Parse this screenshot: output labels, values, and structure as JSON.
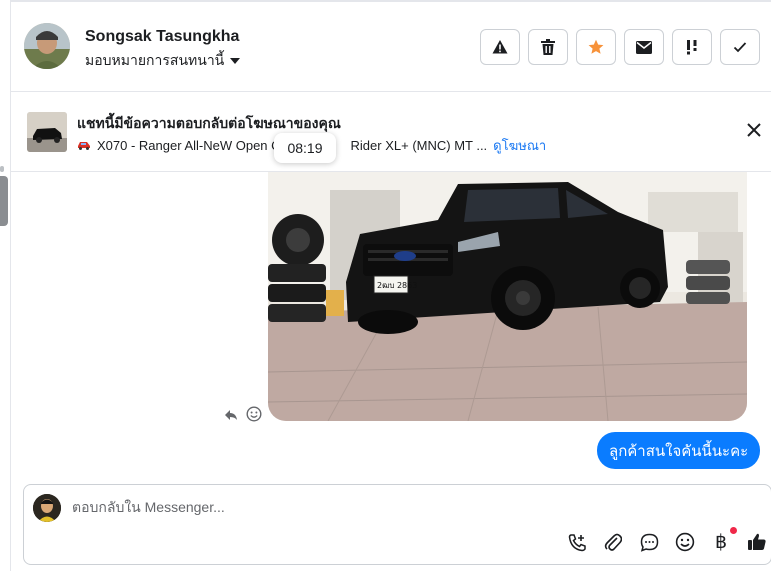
{
  "header": {
    "contact_name": "Songsak Tasungkha",
    "assign_label": "มอบหมายการสนทนานี้",
    "actions": [
      {
        "icon": "warning-icon"
      },
      {
        "icon": "trash-icon"
      },
      {
        "icon": "star-icon",
        "color": "#f7923a"
      },
      {
        "icon": "mail-icon"
      },
      {
        "icon": "follow-up-icon"
      },
      {
        "icon": "checkmark-icon"
      }
    ]
  },
  "ad_banner": {
    "title": "แชทนี้มีข้อความตอบกลับต่อโฆษณาของคุณ",
    "listing": "X070 - Ranger All-NeW Open C",
    "listing_tail": "Rider XL+ (MNC) MT ...",
    "link": "ดูโฆษณา"
  },
  "timestamp_tooltip": "08:19",
  "photo": {
    "description": "black pickup truck in garage",
    "plate": "2ฒบ 2863"
  },
  "messages": [
    {
      "text": "ลูกค้าสนใจคันนี้นะคะ",
      "direction": "outgoing",
      "color": "#0a7cff"
    }
  ],
  "composer": {
    "placeholder": "ตอบกลับใน Messenger..."
  },
  "colors": {
    "accent": "#1877f2",
    "bubble": "#0a7cff",
    "star": "#f7923a",
    "notification": "#f02849"
  }
}
